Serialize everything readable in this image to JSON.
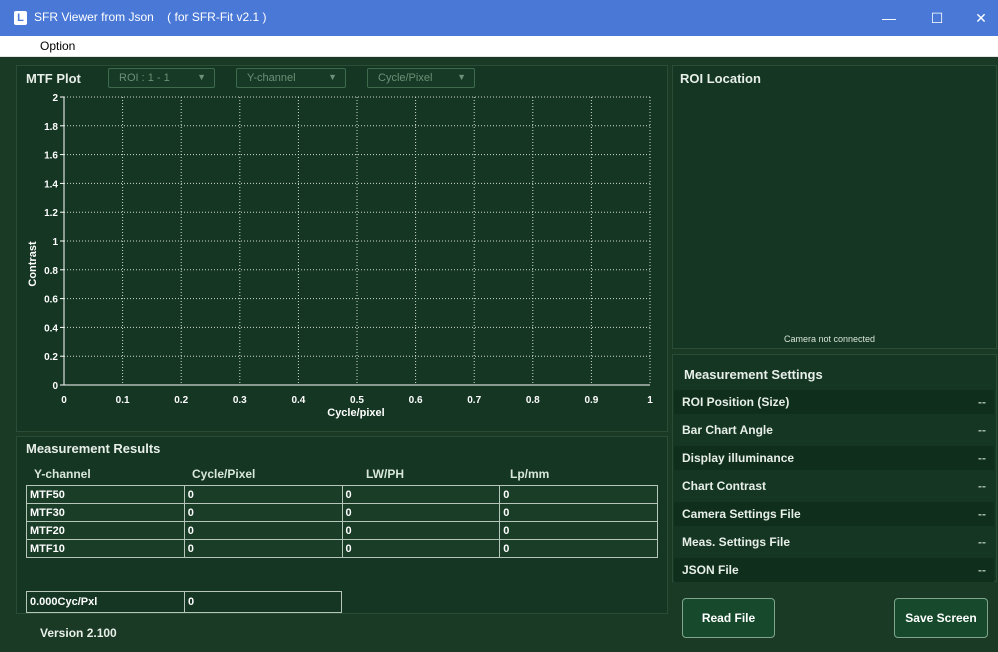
{
  "window": {
    "app_icon": "L",
    "title": "SFR Viewer from Json    ( for SFR-Fit v2.1 )",
    "minimize": "—",
    "maximize": "☐",
    "close": "✕"
  },
  "menu": {
    "option": "Option"
  },
  "mtf_plot": {
    "title": "MTF Plot",
    "roi_select": "ROI : 1 - 1",
    "channel_select": "Y-channel",
    "unit_select": "Cycle/Pixel"
  },
  "chart_data": {
    "type": "line",
    "xlabel": "Cycle/pixel",
    "ylabel": "Contrast",
    "xlim": [
      0,
      1
    ],
    "ylim": [
      0,
      2
    ],
    "x_ticks": [
      "0",
      "0.1",
      "0.2",
      "0.3",
      "0.4",
      "0.5",
      "0.6",
      "0.7",
      "0.8",
      "0.9",
      "1"
    ],
    "y_ticks": [
      "0",
      "0.2",
      "0.4",
      "0.6",
      "0.8",
      "1",
      "1.2",
      "1.4",
      "1.6",
      "1.8",
      "2"
    ],
    "grid": true,
    "series": []
  },
  "roi_location": {
    "title": "ROI Location",
    "status": "Camera not connected"
  },
  "results": {
    "title": "Measurement Results",
    "headers": [
      "Y-channel",
      "Cycle/Pixel",
      "LW/PH",
      "Lp/mm"
    ],
    "rows": [
      [
        "MTF50",
        "0",
        "0",
        "0"
      ],
      [
        "MTF30",
        "0",
        "0",
        "0"
      ],
      [
        "MTF20",
        "0",
        "0",
        "0"
      ],
      [
        "MTF10",
        "0",
        "0",
        "0"
      ]
    ],
    "freq_label": "0.000Cyc/Pxl",
    "freq_value": "0"
  },
  "version": "Version 2.100",
  "settings": {
    "title": "Measurement Settings",
    "rows": [
      {
        "label": "ROI Position (Size)",
        "value": "--"
      },
      {
        "label": "Bar Chart Angle",
        "value": "--"
      },
      {
        "label": "Display illuminance",
        "value": "--"
      },
      {
        "label": "Chart Contrast",
        "value": "--"
      },
      {
        "label": "Camera Settings File",
        "value": "--"
      },
      {
        "label": "Meas. Settings File",
        "value": "--"
      },
      {
        "label": "JSON File",
        "value": "--"
      }
    ]
  },
  "buttons": {
    "read_file": "Read File",
    "save_screen": "Save Screen"
  }
}
